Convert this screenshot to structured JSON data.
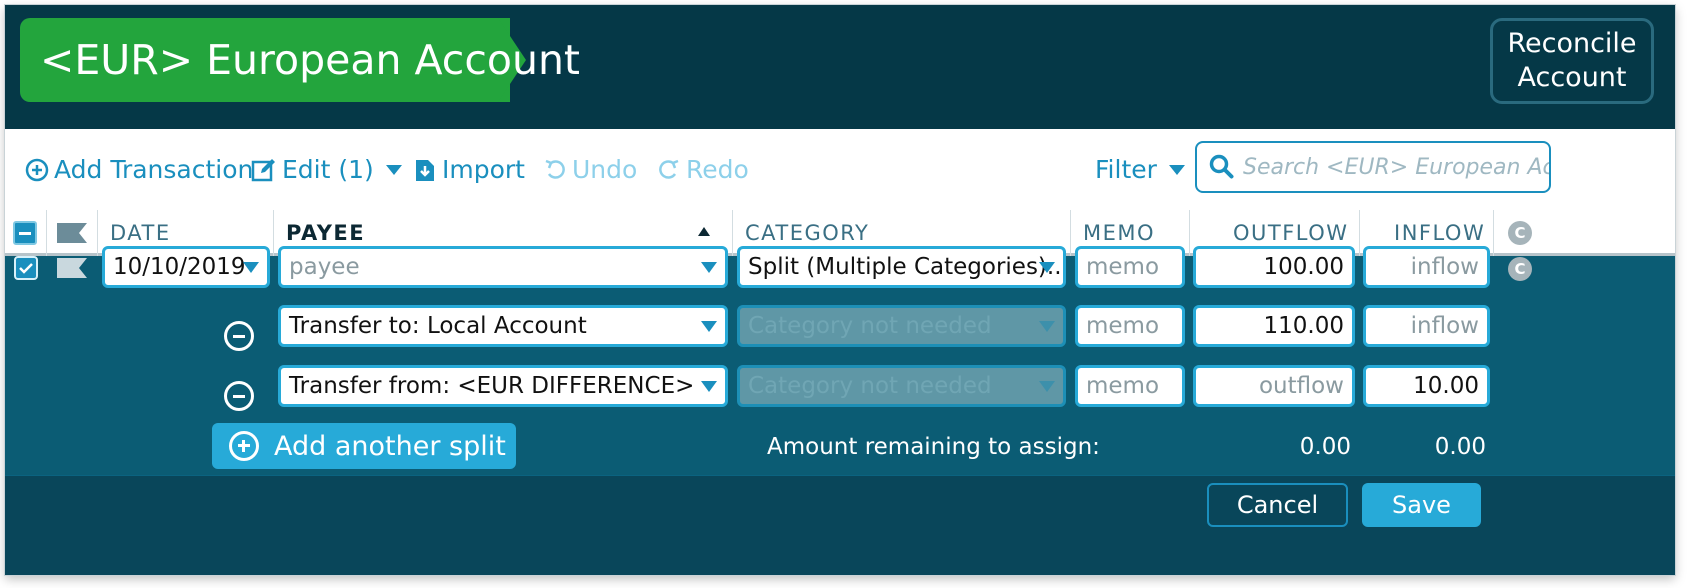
{
  "account": {
    "title": "<EUR> European Account",
    "reconcile_label": "Reconcile Account"
  },
  "toolbar": {
    "add_transaction": "Add Transaction",
    "edit": "Edit (1)",
    "import": "Import",
    "undo": "Undo",
    "redo": "Redo",
    "filter": "Filter",
    "search_placeholder": "Search <EUR> European Account"
  },
  "columns": {
    "date": "DATE",
    "payee": "PAYEE",
    "category": "CATEGORY",
    "memo": "MEMO",
    "outflow": "OUTFLOW",
    "inflow": "INFLOW",
    "cleared": "C"
  },
  "transaction": {
    "date": "10/10/2019",
    "payee_placeholder": "payee",
    "category": "Split (Multiple Categories)...",
    "memo_placeholder": "memo",
    "outflow": "100.00",
    "inflow_placeholder": "inflow",
    "cleared": "C"
  },
  "splits": [
    {
      "payee": "Transfer to: Local Account",
      "category_placeholder": "Category not needed",
      "memo_placeholder": "memo",
      "outflow": "110.00",
      "inflow_placeholder": "inflow"
    },
    {
      "payee": "Transfer from: <EUR DIFFERENCE>",
      "category_placeholder": "Category not needed",
      "memo_placeholder": "memo",
      "outflow_placeholder": "outflow",
      "inflow": "10.00"
    }
  ],
  "add_split_label": "Add another split",
  "remaining": {
    "label": "Amount remaining to assign:",
    "outflow": "0.00",
    "inflow": "0.00"
  },
  "actions": {
    "cancel": "Cancel",
    "save": "Save"
  },
  "colors": {
    "header_bg": "#053847",
    "account_green": "#23a53d",
    "accent_blue": "#27aad8",
    "edit_row_bg": "#0b5c74"
  }
}
